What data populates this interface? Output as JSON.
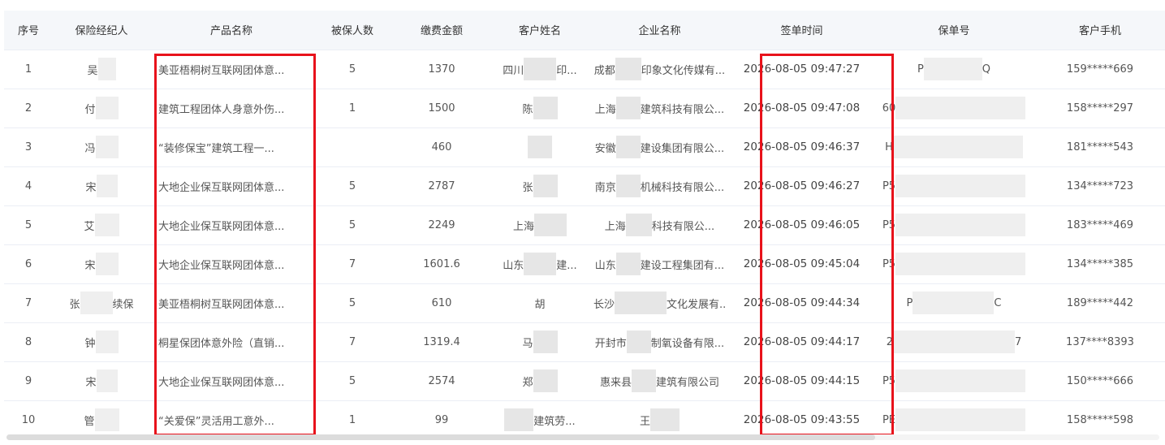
{
  "table": {
    "columns": [
      "序号",
      "保险经纪人",
      "产品名称",
      "被保人数",
      "缴费金额",
      "客户姓名",
      "企业名称",
      "签单时间",
      "保单号",
      "客户手机"
    ],
    "rows": [
      {
        "no": "1",
        "broker": "吴",
        "broker_suffix": "",
        "product": "美亚梧桐树互联网团体意...",
        "insured": "5",
        "amount": "1370",
        "customer": "四川",
        "customer_suffix": "印...",
        "company": "成都",
        "company_suffix": "印象文化传媒有...",
        "time": "2026-08-05 09:47:27",
        "policy": "P",
        "policy_suffix": "Q",
        "phone": "159*****669"
      },
      {
        "no": "2",
        "broker": "付",
        "broker_suffix": "",
        "product": "建筑工程团体人身意外伤...",
        "insured": "1",
        "amount": "1500",
        "customer": "陈",
        "customer_suffix": "",
        "company": "上海",
        "company_suffix": "建筑科技有限公...",
        "time": "2026-08-05 09:47:08",
        "policy": "60",
        "policy_suffix": "",
        "phone": "158*****297"
      },
      {
        "no": "3",
        "broker": "冯",
        "broker_suffix": "",
        "product": "“装修保宝”建筑工程一...",
        "insured": "",
        "amount": "460",
        "customer": "",
        "customer_suffix": "",
        "company": "安徽",
        "company_suffix": "建设集团有限公...",
        "time": "2026-08-05 09:46:37",
        "policy": "H",
        "policy_suffix": "",
        "phone": "181*****543"
      },
      {
        "no": "4",
        "broker": "宋",
        "broker_suffix": "",
        "product": "大地企业保互联网团体意...",
        "insured": "5",
        "amount": "2787",
        "customer": "张",
        "customer_suffix": "",
        "company": "南京",
        "company_suffix": "机械科技有限公...",
        "time": "2026-08-05 09:46:27",
        "policy": "P5",
        "policy_suffix": "",
        "phone": "134*****723"
      },
      {
        "no": "5",
        "broker": "艾",
        "broker_suffix": "",
        "product": "大地企业保互联网团体意...",
        "insured": "5",
        "amount": "2249",
        "customer": "上海",
        "customer_suffix": "",
        "company": "上海",
        "company_suffix": "科技有限公...",
        "time": "2026-08-05 09:46:05",
        "policy": "P5",
        "policy_suffix": "",
        "phone": "183*****469"
      },
      {
        "no": "6",
        "broker": "宋",
        "broker_suffix": "",
        "product": "大地企业保互联网团体意...",
        "insured": "7",
        "amount": "1601.6",
        "customer": "山东",
        "customer_suffix": "建...",
        "company": "山东",
        "company_suffix": "建设工程集团有...",
        "time": "2026-08-05 09:45:04",
        "policy": "P5",
        "policy_suffix": "",
        "phone": "134*****385"
      },
      {
        "no": "7",
        "broker": "张",
        "broker_suffix": "续保",
        "product": "美亚梧桐树互联网团体意...",
        "insured": "5",
        "amount": "610",
        "customer": "胡",
        "customer_suffix": "",
        "company": "长沙",
        "company_suffix": "文化发展有...",
        "time": "2026-08-05 09:44:34",
        "policy": "P",
        "policy_suffix": "C",
        "phone": "189*****442"
      },
      {
        "no": "8",
        "broker": "钟",
        "broker_suffix": "",
        "product": "桐星保团体意外险（直销...",
        "insured": "7",
        "amount": "1319.4",
        "customer": "马",
        "customer_suffix": "",
        "company": "开封市",
        "company_suffix": "制氧设备有限...",
        "time": "2026-08-05 09:44:17",
        "policy": "2",
        "policy_suffix": "7",
        "phone": "137****8393"
      },
      {
        "no": "9",
        "broker": "宋",
        "broker_suffix": "",
        "product": "大地企业保互联网团体意...",
        "insured": "5",
        "amount": "2574",
        "customer": "郑",
        "customer_suffix": "",
        "company": "惠来县",
        "company_suffix": "建筑有限公司",
        "time": "2026-08-05 09:44:15",
        "policy": "P5",
        "policy_suffix": "",
        "phone": "150*****666"
      },
      {
        "no": "10",
        "broker": "管",
        "broker_suffix": "",
        "product": "“关爱保”灵活用工意外...",
        "insured": "1",
        "amount": "99",
        "customer": "",
        "customer_suffix": "建筑劳...",
        "company": "王",
        "company_suffix": "",
        "time": "2026-08-05 09:43:55",
        "policy": "PE",
        "policy_suffix": "",
        "phone": "158*****598"
      }
    ]
  },
  "highlight_color": "#e8121b"
}
